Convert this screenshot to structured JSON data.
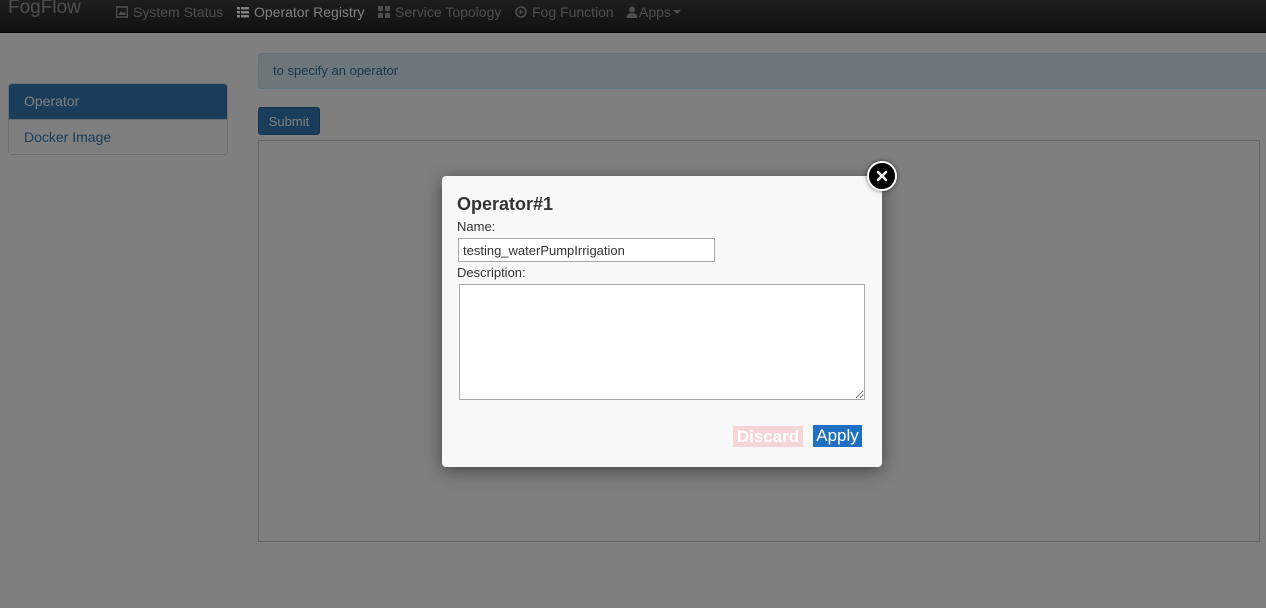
{
  "navbar": {
    "brand": "FogFlow",
    "items": [
      {
        "label": "System Status",
        "icon": "picture-icon"
      },
      {
        "label": "Operator Registry",
        "icon": "list-icon",
        "active": true
      },
      {
        "label": "Service Topology",
        "icon": "grid-icon"
      },
      {
        "label": "Fog Function",
        "icon": "play-circle-icon"
      },
      {
        "label": "Apps",
        "icon": "user-icon"
      }
    ]
  },
  "sidebar": {
    "items": [
      {
        "label": "Operator",
        "active": true
      },
      {
        "label": "Docker Image"
      }
    ]
  },
  "main": {
    "info_text": "to specify an operator",
    "submit_label": "Submit"
  },
  "modal": {
    "title": "Operator#1",
    "name_label": "Name:",
    "name_value": "testing_waterPumpIrrigation",
    "description_label": "Description:",
    "description_value": "",
    "discard_label": "Discard",
    "apply_label": "Apply"
  },
  "colors": {
    "navbar_bg": "#222222",
    "primary": "#337ab7",
    "apply": "#1f6fc2",
    "discard": "#f5d5d5"
  }
}
